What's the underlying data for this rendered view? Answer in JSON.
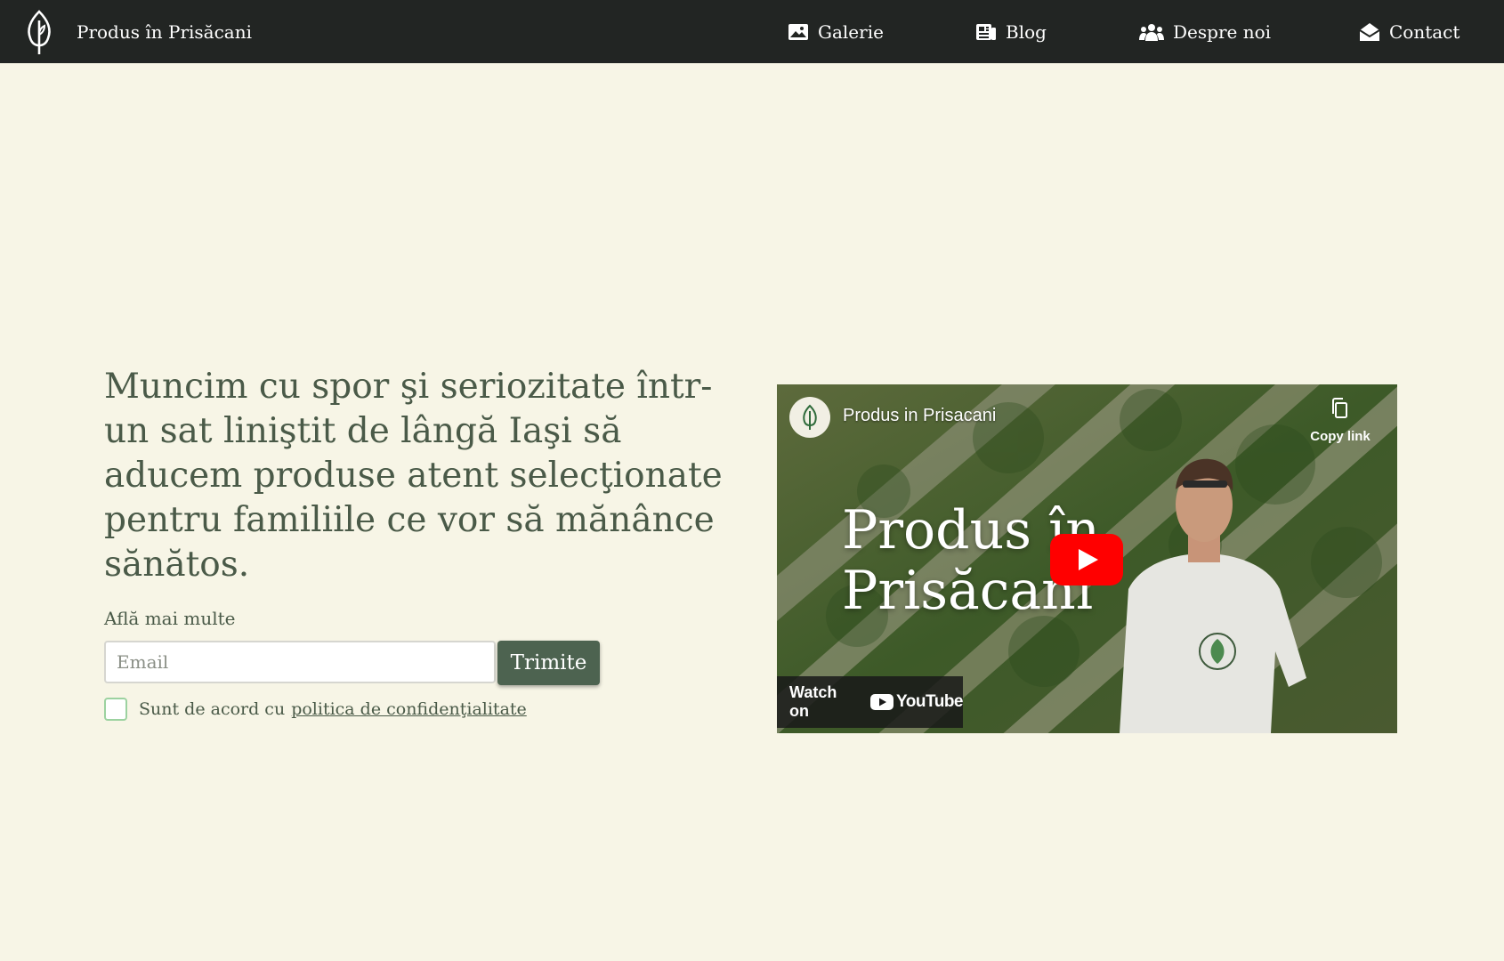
{
  "nav": {
    "brand": "Produs în Prisăcani",
    "items": [
      {
        "label": "Galerie",
        "icon": "image-icon"
      },
      {
        "label": "Blog",
        "icon": "newspaper-icon"
      },
      {
        "label": "Despre noi",
        "icon": "people-icon"
      },
      {
        "label": "Contact",
        "icon": "envelope-open-icon"
      }
    ]
  },
  "hero": {
    "headline": "Muncim cu spor şi seriozitate într-un sat liniştit de lângă Iaşi să aducem produse atent selecţionate pentru familiile ce vor să mănânce sănătos.",
    "learn_more": "Află mai multe",
    "email_placeholder": "Email",
    "submit_label": "Trimite",
    "consent_text": "Sunt de acord cu",
    "policy_link": "politica de confidenţialitate"
  },
  "video": {
    "channel_name": "Produs in Prisacani",
    "copy_link": "Copy link",
    "title": "Produs în Prisăcani",
    "watch_on": "Watch on",
    "youtube": "YouTube"
  },
  "colors": {
    "navbar_bg": "#222523",
    "page_bg": "#f7f5e6",
    "text": "#4a5a48",
    "button_bg": "#4d6350",
    "checkbox_border": "#9cd2a0",
    "youtube_red": "#ff0000"
  }
}
